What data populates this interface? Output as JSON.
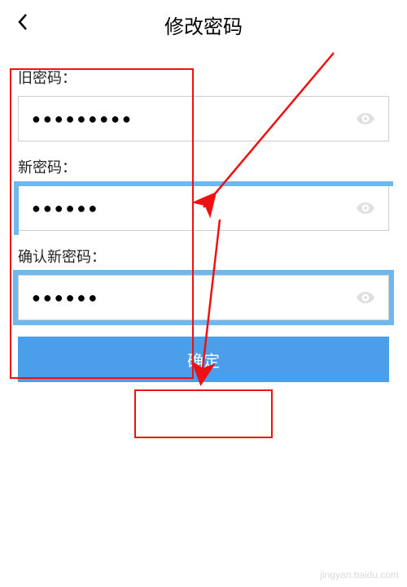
{
  "header": {
    "title": "修改密码"
  },
  "form": {
    "old_password": {
      "label": "旧密码：",
      "value": "●●●●●●●●●"
    },
    "new_password": {
      "label": "新密码：",
      "value": "●●●●●●"
    },
    "confirm_password": {
      "label": "确认新密码：",
      "value": "●●●●●●"
    }
  },
  "submit": {
    "label": "确定"
  },
  "watermark": "jingyan.baidu.com"
}
